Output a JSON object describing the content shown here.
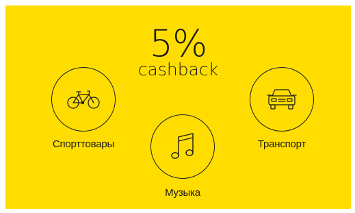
{
  "banner": {
    "percent": "5%",
    "caption": "cashback",
    "background_color": "#ffdd00",
    "text_color": "#1a1a1a"
  },
  "categories": [
    {
      "label": "Спорттовары",
      "icon": "bicycle-icon"
    },
    {
      "label": "Музыка",
      "icon": "music-note-icon"
    },
    {
      "label": "Транспорт",
      "icon": "car-icon"
    }
  ]
}
